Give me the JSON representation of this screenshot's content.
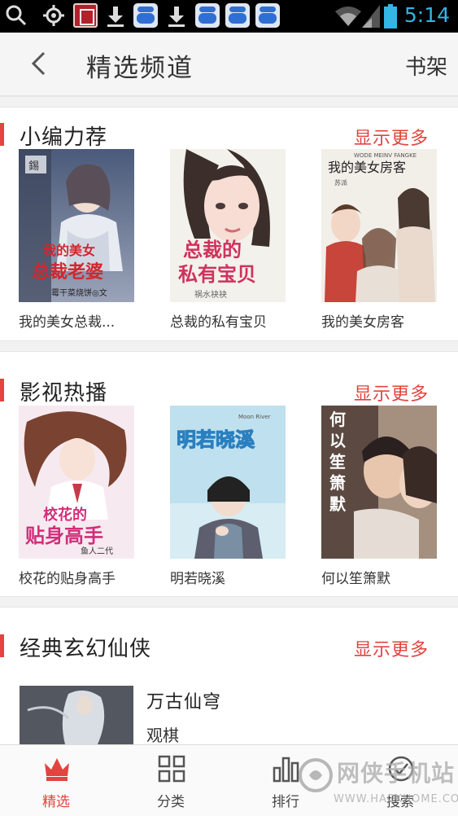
{
  "status_bar": {
    "time": "5:14",
    "icons": [
      "search-icon",
      "location-icon",
      "app-notification-icon",
      "download-icon",
      "baidu-icon",
      "download-icon",
      "baidu-icon",
      "baidu-icon",
      "wifi-icon",
      "signal-icon",
      "battery-icon"
    ]
  },
  "header": {
    "title": "精选频道",
    "right_label": "书架"
  },
  "sections": [
    {
      "title": "小编力荐",
      "more_label": "显示更多",
      "books": [
        {
          "title": "我的美女总裁...",
          "cover_text_1": "我的美女",
          "cover_text_2": "总裁老婆",
          "cover_text_3": "霉干菜烧饼◎文",
          "cover_badge": "錫"
        },
        {
          "title": "总裁的私有宝贝",
          "cover_text_1": "总裁的",
          "cover_text_2": "私有宝贝",
          "cover_text_3": "祸水袂袂"
        },
        {
          "title": "我的美女房客",
          "cover_text_1": "我的美女房客",
          "cover_text_2": "WODE MEINV FANGKE",
          "cover_text_3": "苏派"
        }
      ]
    },
    {
      "title": "影视热播",
      "more_label": "显示更多",
      "books": [
        {
          "title": "校花的贴身高手",
          "cover_text_1": "校花的",
          "cover_text_2": "贴身高手",
          "cover_text_3": "鱼人二代"
        },
        {
          "title": "明若晓溪",
          "cover_text_1": "明若晓溪",
          "cover_text_2": "Moon River",
          "cover_text_3": ""
        },
        {
          "title": "何以笙箫默",
          "cover_text_1": "何",
          "cover_text_2": "以",
          "cover_text_3": "笙",
          "cover_text_4": "箫",
          "cover_text_5": "默"
        }
      ]
    },
    {
      "title": "经典玄幻仙侠",
      "more_label": "显示更多",
      "list_item": {
        "title": "万古仙穹",
        "author": "观棋"
      }
    }
  ],
  "bottom_nav": [
    {
      "label": "精选",
      "icon": "crown-icon",
      "active": true
    },
    {
      "label": "分类",
      "icon": "grid-icon",
      "active": false
    },
    {
      "label": "排行",
      "icon": "bar-chart-icon",
      "active": false
    },
    {
      "label": "搜索",
      "icon": "search-icon",
      "active": false
    }
  ],
  "watermark": {
    "text": "网侠手机站",
    "url": "WWW.HACKHOME.COM"
  },
  "colors": {
    "accent": "#e2443f",
    "status_time": "#33b5e5"
  }
}
